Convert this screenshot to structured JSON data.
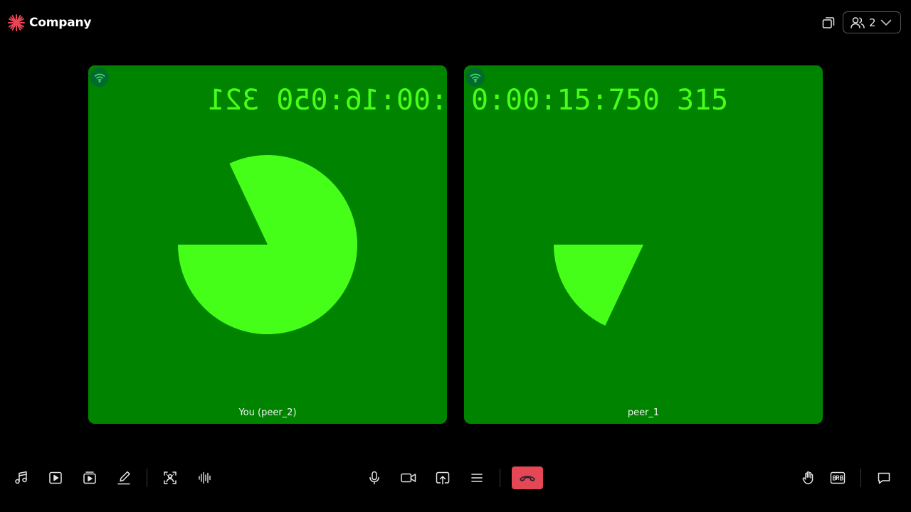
{
  "header": {
    "brand_name": "Company",
    "brand_icon": "asterisk-logo-icon",
    "participant_count": "2"
  },
  "tiles": [
    {
      "name": "You (peer_2)",
      "timer": "0:00:16:050 321",
      "mirrored": true,
      "pie_fraction": 0.82
    },
    {
      "name": "peer_1",
      "timer": "0:00:15:750 315",
      "mirrored": false,
      "pie_fraction": 0.18
    }
  ],
  "colors": {
    "brand_accent": "#e54757",
    "tile_background": "#008400",
    "timer_green": "#45ff18",
    "leave_button": "#e54757"
  },
  "toolbar": {
    "left_icons": [
      "music-icon",
      "play-video-icon",
      "video-gallery-icon",
      "pencil-whiteboard-icon",
      "virtual-background-icon",
      "audio-waveform-icon"
    ],
    "center_icons": [
      "microphone-icon",
      "camera-icon",
      "screen-share-icon",
      "menu-icon",
      "leave-call-icon"
    ],
    "right_icons": [
      "raise-hand-icon",
      "brb-icon",
      "chat-icon"
    ]
  }
}
